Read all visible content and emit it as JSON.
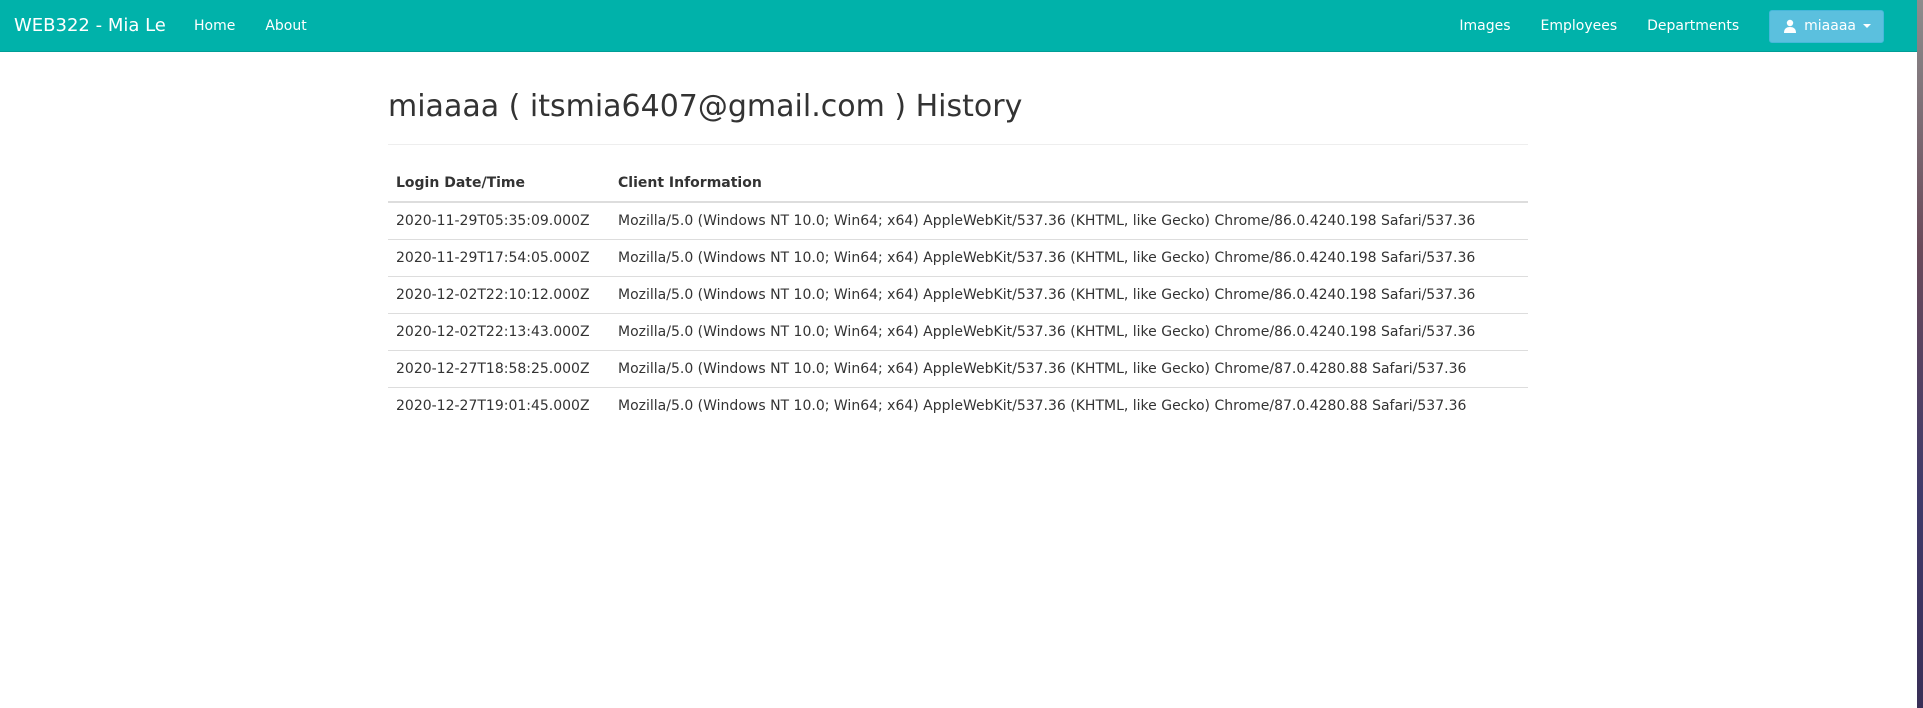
{
  "navbar": {
    "brand": "WEB322 - Mia Le",
    "left_links": [
      "Home",
      "About"
    ],
    "right_links": [
      "Images",
      "Employees",
      "Departments"
    ],
    "user_menu_label": "miaaaa",
    "background_color": "#00b2aa",
    "user_button_color": "#5bc0de"
  },
  "main": {
    "title": "miaaaa ( itsmia6407@gmail.com ) History",
    "table": {
      "headers": [
        "Login Date/Time",
        "Client Information"
      ],
      "rows": [
        [
          "2020-11-29T05:35:09.000Z",
          "Mozilla/5.0 (Windows NT 10.0; Win64; x64) AppleWebKit/537.36 (KHTML, like Gecko) Chrome/86.0.4240.198 Safari/537.36"
        ],
        [
          "2020-11-29T17:54:05.000Z",
          "Mozilla/5.0 (Windows NT 10.0; Win64; x64) AppleWebKit/537.36 (KHTML, like Gecko) Chrome/86.0.4240.198 Safari/537.36"
        ],
        [
          "2020-12-02T22:10:12.000Z",
          "Mozilla/5.0 (Windows NT 10.0; Win64; x64) AppleWebKit/537.36 (KHTML, like Gecko) Chrome/86.0.4240.198 Safari/537.36"
        ],
        [
          "2020-12-02T22:13:43.000Z",
          "Mozilla/5.0 (Windows NT 10.0; Win64; x64) AppleWebKit/537.36 (KHTML, like Gecko) Chrome/86.0.4240.198 Safari/537.36"
        ],
        [
          "2020-12-27T18:58:25.000Z",
          "Mozilla/5.0 (Windows NT 10.0; Win64; x64) AppleWebKit/537.36 (KHTML, like Gecko) Chrome/87.0.4280.88 Safari/537.36"
        ],
        [
          "2020-12-27T19:01:45.000Z",
          "Mozilla/5.0 (Windows NT 10.0; Win64; x64) AppleWebKit/537.36 (KHTML, like Gecko) Chrome/87.0.4280.88 Safari/537.36"
        ]
      ]
    }
  },
  "icons": {
    "user": "user-icon",
    "dropdown": "caret-down-icon"
  }
}
